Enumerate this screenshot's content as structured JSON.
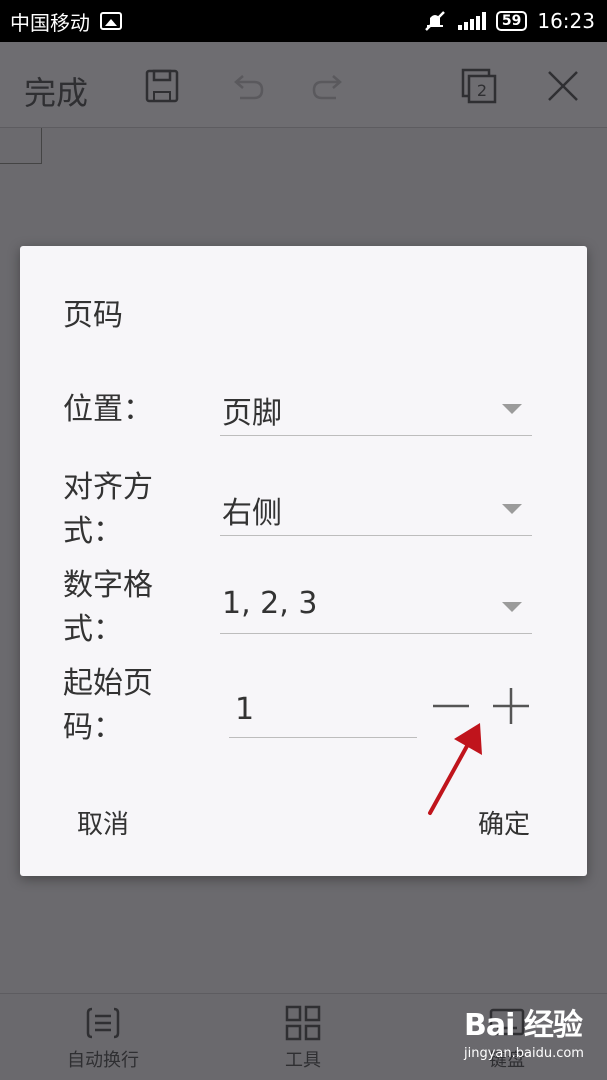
{
  "status_bar": {
    "carrier": "中国移动",
    "battery": "59",
    "time": "16:23"
  },
  "toolbar": {
    "done_label": "完成",
    "page_count": "2"
  },
  "dialog": {
    "title": "页码",
    "position": {
      "label": "位置：",
      "value": "页脚"
    },
    "alignment": {
      "label": "对齐方式：",
      "value": "右侧"
    },
    "number_format": {
      "label": "数字格式：",
      "value": "1, 2, 3"
    },
    "start_page": {
      "label": "起始页码：",
      "value": "1"
    },
    "cancel_label": "取消",
    "confirm_label": "确定"
  },
  "bottom_bar": {
    "items": [
      {
        "label": "自动换行"
      },
      {
        "label": "工具"
      },
      {
        "label": "键盘"
      }
    ]
  },
  "watermark": {
    "logo": "Bai 经验",
    "sub": "jingyan.baidu.com"
  },
  "colors": {
    "overlay": "#6b6a6e",
    "dialog_bg": "#f7f6f9",
    "annotation": "#c0141c"
  }
}
